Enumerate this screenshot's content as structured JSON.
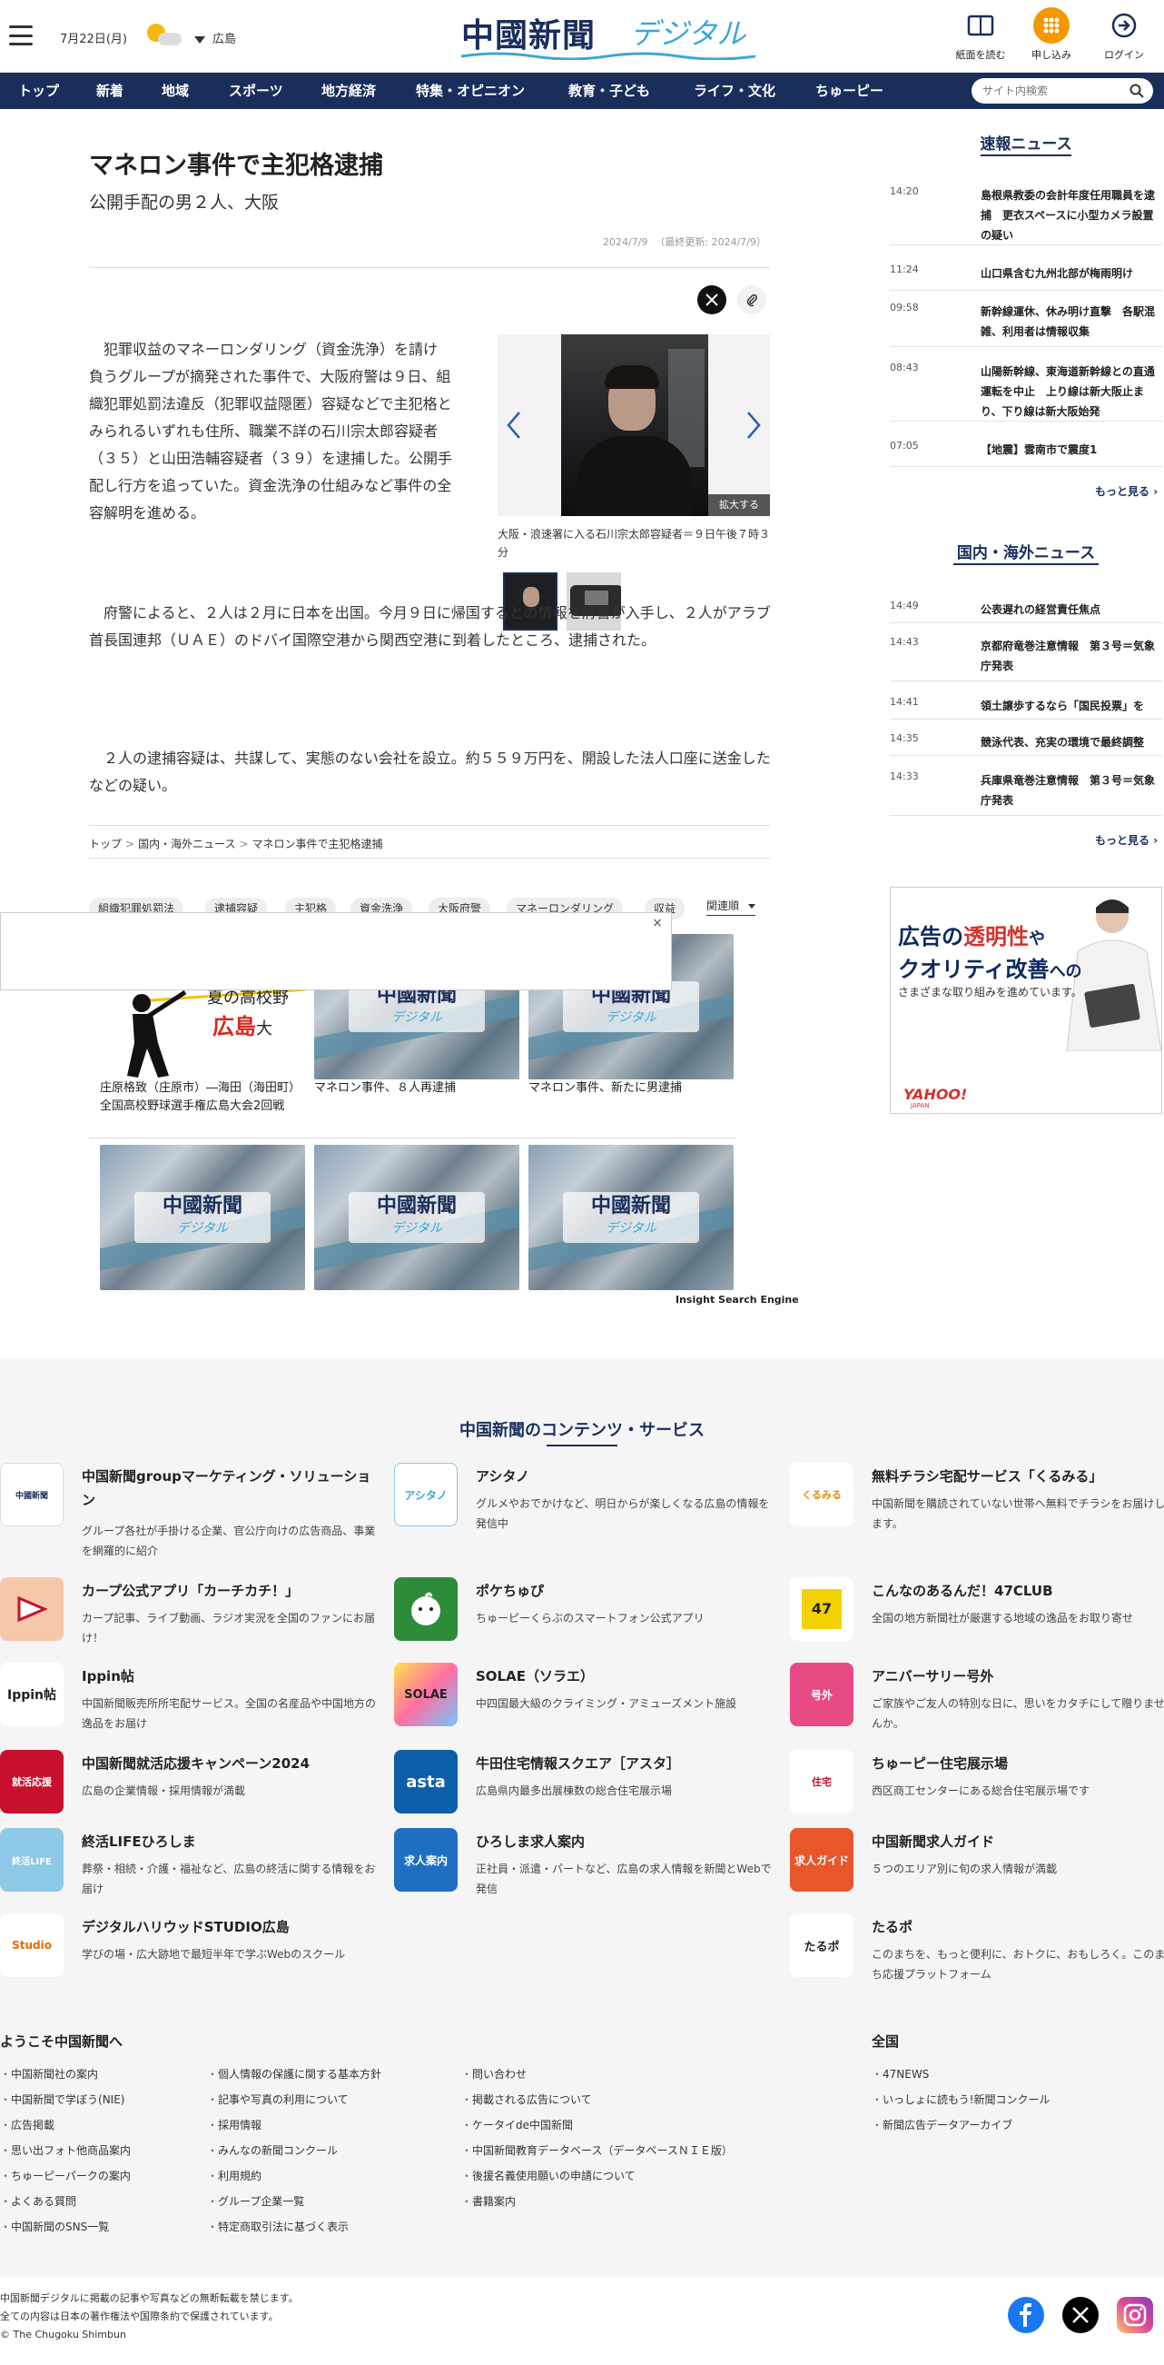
{
  "header": {
    "date": "7月22日(月)",
    "region": "広島",
    "logo_kanji": "中國新聞",
    "logo_digital": "デジタル",
    "read_paper": "紙面を読む",
    "apply": "申し込み",
    "login": "ログイン"
  },
  "nav": {
    "items": [
      "トップ",
      "新着",
      "地域",
      "スポーツ",
      "地方経済",
      "特集・オピニオン",
      "教育・子ども",
      "ライフ・文化",
      "ちゅーピー"
    ],
    "search_placeholder": "サイト内検索"
  },
  "article": {
    "title": "マネロン事件で主犯格逮捕",
    "subtitle": "公開手配の男２人、大阪",
    "published": "2024/7/9",
    "updated": "（最終更新: 2024/7/9）",
    "p1": "犯罪収益のマネーロンダリング（資金洗浄）を請け負うグループが摘発された事件で、大阪府警は９日、組織犯罪処罰法違反（犯罪収益隠匿）容疑などで主犯格とみられるいずれも住所、職業不詳の石川宗太郎容疑者（３５）と山田浩輔容疑者（３９）を逮捕した。公開手配し行方を追っていた。資金洗浄の仕組みなど事件の全容解明を進める。",
    "p2": "府警によると、２人は２月に日本を出国。今月９日に帰国するとの情報を府警が入手し、２人がアラブ首長国連邦（ＵＡＥ）のドバイ国際空港から関西空港に到着したところ、逮捕された。",
    "p3": "２人の逮捕容疑は、共謀して、実態のない会社を設立。約５５９万円を、開設した法人口座に送金したなどの疑い。",
    "photo_caption": "大阪・浪速署に入る石川宗太郎容疑者＝９日午後７時３分",
    "enlarge": "拡大する"
  },
  "breadcrumb": [
    "トップ",
    "国内・海外ニュース",
    "マネロン事件で主犯格逮捕"
  ],
  "tags": [
    "組織犯罪処罰法",
    "逮捕容疑",
    "主犯格",
    "資金洗浄",
    "大阪府警",
    "マネーロンダリング",
    "収益"
  ],
  "sort_label": "関連順",
  "popup_close": "×",
  "related": {
    "baseball_title": "夏の高校野",
    "baseball_hiroshima": "広島",
    "baseball_suffix": "大",
    "badge_kanji": "中國新聞",
    "badge_digital": "デジタル",
    "captions": [
      "庄原格致（庄原市）―海田（海田町）　全国高校野球選手権広島大会2回戦",
      "マネロン事件、８人再逮捕",
      "マネロン事件、新たに男逮捕"
    ],
    "engine": "Insight Search Engine"
  },
  "sidebar": {
    "breaking_title": "速報ニュース",
    "breaking": [
      {
        "time": "14:20",
        "headline": "島根県教委の会計年度任用職員を逮捕　更衣スペースに小型カメラ設置の疑い"
      },
      {
        "time": "11:24",
        "headline": "山口県含む九州北部が梅雨明け"
      },
      {
        "time": "09:58",
        "headline": "新幹線運休、休み明け直撃　各駅混雑、利用者は情報収集"
      },
      {
        "time": "08:43",
        "headline": "山陽新幹線、東海道新幹線との直通運転を中止　上り線は新大阪止まり、下り線は新大阪始発"
      },
      {
        "time": "07:05",
        "headline": "【地震】雲南市で震度1"
      }
    ],
    "more": "もっと見る",
    "intl_title": "国内・海外ニュース",
    "intl": [
      {
        "time": "14:49",
        "headline": "公表遅れの経営責任焦点"
      },
      {
        "time": "14:43",
        "headline": "京都府竜巻注意情報　第３号＝気象庁発表"
      },
      {
        "time": "14:41",
        "headline": "領土譲歩するなら「国民投票」を"
      },
      {
        "time": "14:35",
        "headline": "競泳代表、充実の環境で最終調整"
      },
      {
        "time": "14:33",
        "headline": "兵庫県竜巻注意情報　第３号＝気象庁発表"
      }
    ],
    "ad_l1a": "広告の",
    "ad_l1b": "透明性",
    "ad_l1c": "や",
    "ad_l2a": "クオリティ改善",
    "ad_l2b": "への",
    "ad_l3": "さまざまな取り組みを進めています。",
    "ad_brand": "YAHOO!",
    "ad_brand_sub": "JAPAN"
  },
  "services": {
    "title": "中国新聞のコンテンツ・サービス",
    "items": [
      {
        "name": "中国新聞groupマーケティング・ソリューション",
        "desc": "グループ各社が手掛ける企業、官公庁向けの広告商品、事業を網羅的に紹介",
        "icon": "中國新聞"
      },
      {
        "name": "アシタノ",
        "desc": "グルメやおでかけなど、明日からが楽しくなる広島の情報を発信中",
        "icon": "アシタノ"
      },
      {
        "name": "無料チラシ宅配サービス「くるみる」",
        "desc": "中国新聞を購読されていない世帯へ無料でチラシをお届けします。",
        "icon": "くるみる"
      },
      {
        "name": "カープ公式アプリ「カーチカチ！」",
        "desc": "カープ記事、ライブ動画、ラジオ実況を全国のファンにお届け！",
        "icon": ""
      },
      {
        "name": "ポケちゅぴ",
        "desc": "ちゅーピーくらぶのスマートフォン公式アプリ",
        "icon": ""
      },
      {
        "name": "こんなのあるんだ！47CLUB",
        "desc": "全国の地方新聞社が厳選する地域の逸品をお取り寄せ",
        "icon": "47"
      },
      {
        "name": "Ippin帖",
        "desc": "中国新聞販売所所宅配サービス。全国の名産品や中国地方の逸品をお届け",
        "icon": "Ippin帖"
      },
      {
        "name": "SOLAE（ソラエ）",
        "desc": "中四国最大級のクライミング・アミューズメント施設",
        "icon": "SOLAE"
      },
      {
        "name": "アニバーサリー号外",
        "desc": "ご家族やご友人の特別な日に、思いをカタチにして贈りませんか。",
        "icon": "号外"
      },
      {
        "name": "中国新聞就活応援キャンペーン2024",
        "desc": "広島の企業情報・採用情報が満載",
        "icon": "就活応援"
      },
      {
        "name": "牛田住宅情報スクエア［アスタ］",
        "desc": "広島県内最多出展棟数の総合住宅展示場",
        "icon": "asta"
      },
      {
        "name": "ちゅーピー住宅展示場",
        "desc": "西区商工センターにある総合住宅展示場です",
        "icon": "住宅"
      },
      {
        "name": "終活LIFEひろしま",
        "desc": "葬祭・相続・介護・福祉など、広島の終活に関する情報をお届け",
        "icon": "終活LIFE"
      },
      {
        "name": "ひろしま求人案内",
        "desc": "正社員・派遣・パートなど、広島の求人情報を新聞とWebで発信",
        "icon": "求人案内"
      },
      {
        "name": "中国新聞求人ガイド",
        "desc": "５つのエリア別に旬の求人情報が満載",
        "icon": "求人ガイド"
      },
      {
        "name": "デジタルハリウッドSTUDIO広島",
        "desc": "学びの場・広大跡地で最短半年で学ぶWebのスクール",
        "icon": "Studio"
      },
      {
        "name": "たるポ",
        "desc": "このまちを、もっと便利に、おトクに、おもしろく。このまち応援プラットフォーム",
        "icon": "たるポ"
      }
    ]
  },
  "footer": {
    "welcome_title": "ようこそ中国新聞へ",
    "col1": [
      "中国新聞社の案内",
      "中国新聞で学ぼう(NIE)",
      "広告掲載",
      "思い出フォト他商品案内",
      "ちゅーピーパークの案内",
      "よくある質問",
      "中国新聞のSNS一覧"
    ],
    "col2": [
      "個人情報の保護に関する基本方針",
      "記事や写真の利用について",
      "採用情報",
      "みんなの新聞コンクール",
      "利用規約",
      "グループ企業一覧",
      "特定商取引法に基づく表示"
    ],
    "col3": [
      "問い合わせ",
      "掲載される広告について",
      "ケータイde中国新聞",
      "中国新聞教育データベース（データベースＮＩＥ版）",
      "後援名義使用願いの申請について",
      "書籍案内"
    ],
    "national_title": "全国",
    "col4": [
      "47NEWS",
      "いっしょに読もう!新聞コンクール",
      "新聞広告データアーカイブ"
    ],
    "copy1": "中国新聞デジタルに掲載の記事や写真などの無断転載を禁じます。",
    "copy2": "全ての内容は日本の著作権法や国際条約で保護されています。",
    "copy3": "© The Chugoku Shimbun"
  },
  "colors": {
    "navy": "#1a2e5c",
    "orange": "#f39800",
    "accent": "#3aa7d6"
  }
}
